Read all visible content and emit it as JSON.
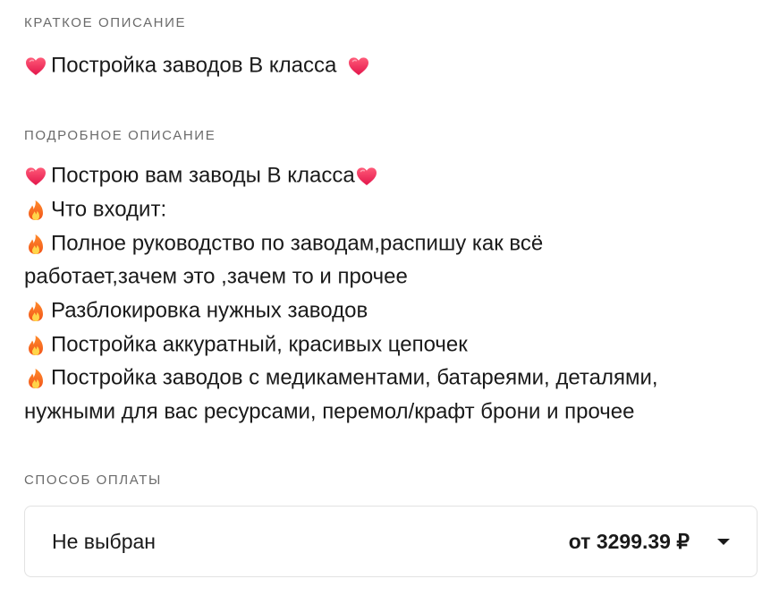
{
  "short_description": {
    "label": "КРАТКОЕ ОПИСАНИЕ",
    "text": "Постройка заводов В класса",
    "icons": [
      "heart-icon",
      "heart-icon"
    ]
  },
  "detailed_description": {
    "label": "ПОДРОБНОЕ ОПИСАНИЕ",
    "lines": [
      {
        "icon": "heart-icon",
        "text": "Построю вам заводы В класса",
        "trailing_icon": "heart-icon"
      },
      {
        "icon": "fire-icon",
        "text": "Что входит:"
      },
      {
        "icon": "fire-icon",
        "text": "Полное руководство по заводам,распишу как всё"
      },
      {
        "text": "работает,зачем это ,зачем то и прочее"
      },
      {
        "icon": "fire-icon",
        "text": "Разблокировка нужных заводов"
      },
      {
        "icon": "fire-icon",
        "text": "Постройка аккуратный, красивых цепочек"
      },
      {
        "icon": "fire-icon",
        "text": "Постройка заводов с медикаментами, батареями, деталями,"
      },
      {
        "text": "нужными для вас ресурсами, перемол/крафт брони и прочее"
      }
    ]
  },
  "payment": {
    "label": "СПОСОБ ОПЛАТЫ",
    "selected": "Не выбран",
    "price": "от 3299.39 ₽",
    "icon": "chevron-down-icon"
  }
}
